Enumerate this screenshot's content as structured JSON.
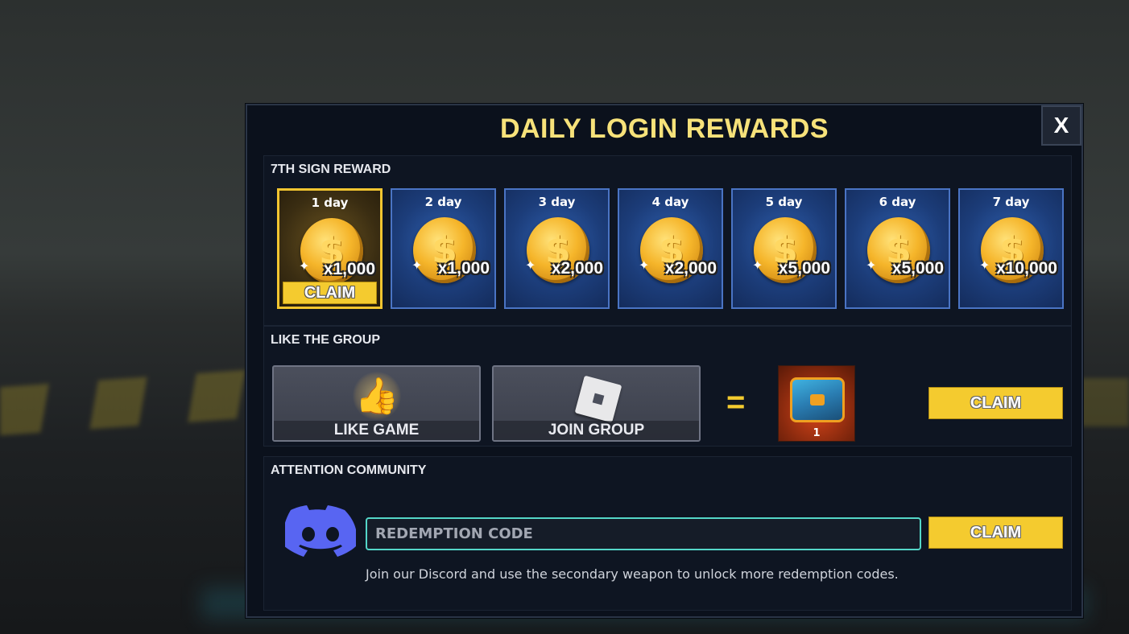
{
  "title": "DAILY LOGIN REWARDS",
  "close_label": "X",
  "rewards": {
    "section_title": "7TH SIGN REWARD",
    "days": [
      {
        "label": "1  day",
        "amount": "x1,000",
        "active": true
      },
      {
        "label": "2  day",
        "amount": "x1,000",
        "active": false
      },
      {
        "label": "3  day",
        "amount": "x2,000",
        "active": false
      },
      {
        "label": "4  day",
        "amount": "x2,000",
        "active": false
      },
      {
        "label": "5  day",
        "amount": "x5,000",
        "active": false
      },
      {
        "label": "6  day",
        "amount": "x5,000",
        "active": false
      },
      {
        "label": "7  day",
        "amount": "x10,000",
        "active": false
      }
    ],
    "claim_label": "CLAIM"
  },
  "group": {
    "section_title": "LIKE THE GROUP",
    "like_label": "LIKE  GAME",
    "join_label": "JOIN GROUP",
    "equals": "=",
    "reward_count": "1",
    "claim_label": "CLAIM"
  },
  "community": {
    "section_title": "ATTENTION COMMUNITY",
    "code_placeholder": "REDEMPTION CODE",
    "claim_label": "CLAIM",
    "hint": "Join our Discord and use the secondary weapon to unlock more redemption codes."
  },
  "colors": {
    "title": "#f7e27a",
    "claim": "#f4cb2f",
    "input_border": "#54d6c8",
    "discord": "#5865f2"
  }
}
